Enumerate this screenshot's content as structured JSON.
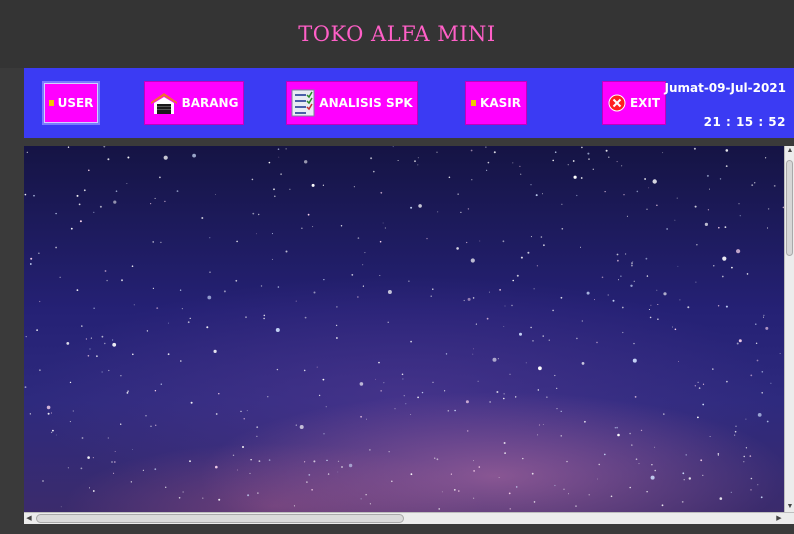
{
  "app": {
    "title": "TOKO ALFA MINI"
  },
  "toolbar": {
    "buttons": [
      {
        "label": "USER",
        "icon": "user-icon"
      },
      {
        "label": "BARANG",
        "icon": "warehouse-icon"
      },
      {
        "label": "ANALISIS SPK",
        "icon": "checklist-icon"
      },
      {
        "label": "KASIR",
        "icon": "cashier-icon"
      },
      {
        "label": "EXIT",
        "icon": "close-circle-icon"
      }
    ],
    "date": "Jumat-09-Jul-2021",
    "time": "21 : 15 : 52"
  },
  "colors": {
    "title_bar": "#343434",
    "title_text": "#ff5fc7",
    "toolbar_bg": "#3b3bf3",
    "button_bg": "#ff00ff",
    "button_text": "#ffffff",
    "exit_icon": "#ff2020",
    "warehouse_icon": "#f07030"
  },
  "content": {
    "background": "starry-night-sky-image"
  }
}
